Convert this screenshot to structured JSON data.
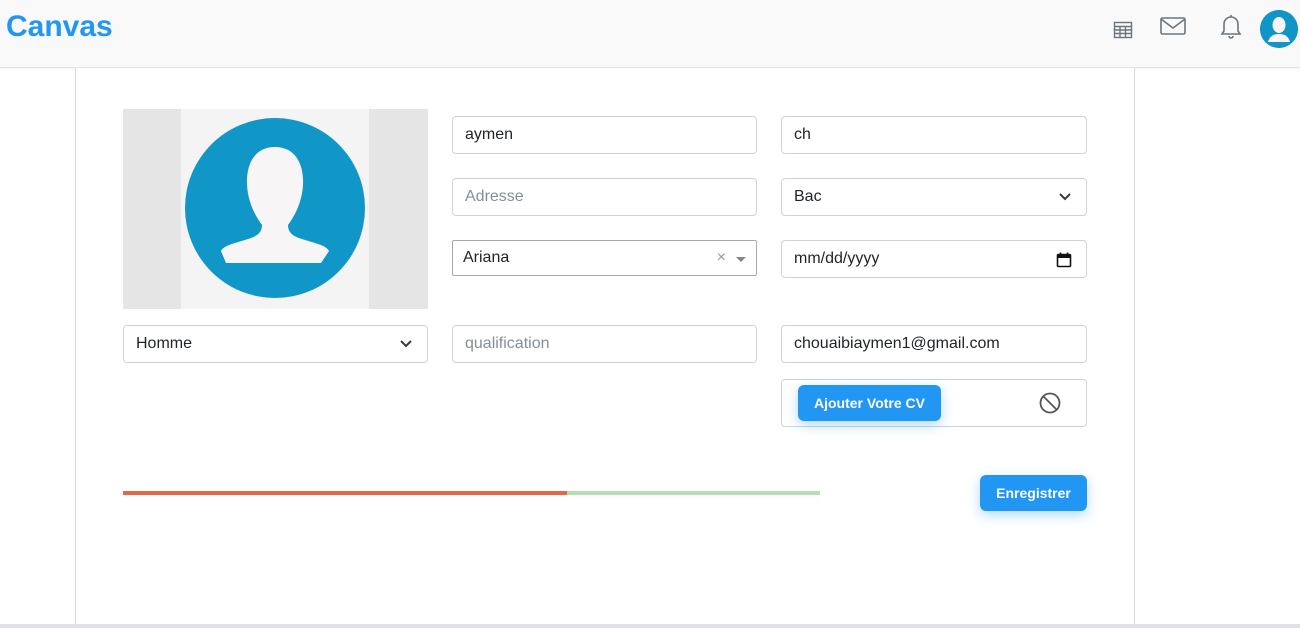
{
  "app": {
    "brand": "Canvas"
  },
  "header_icons": [
    "table-icon",
    "mail-icon",
    "bell-icon",
    "user-avatar-icon"
  ],
  "form": {
    "first_name": {
      "value": "aymen"
    },
    "last_name": {
      "value": "ch"
    },
    "address": {
      "placeholder": "Adresse"
    },
    "education": {
      "selected": "Bac"
    },
    "city": {
      "selected": "Ariana",
      "clear": "×"
    },
    "birth_date": {
      "placeholder": "mm/dd/yyyy"
    },
    "gender": {
      "selected": "Homme"
    },
    "qualification": {
      "placeholder": "qualification"
    },
    "email": {
      "value": "chouaibiaymen1@gmail.com"
    },
    "cv_button": "Ajouter Votre CV",
    "save_button": "Enregistrer"
  },
  "progress": {
    "fraction": 0.637
  },
  "colors": {
    "accent": "#2196f3",
    "avatar": "#1195c6",
    "progress_fill": "#e0684b",
    "progress_track": "#b6dcb3"
  }
}
